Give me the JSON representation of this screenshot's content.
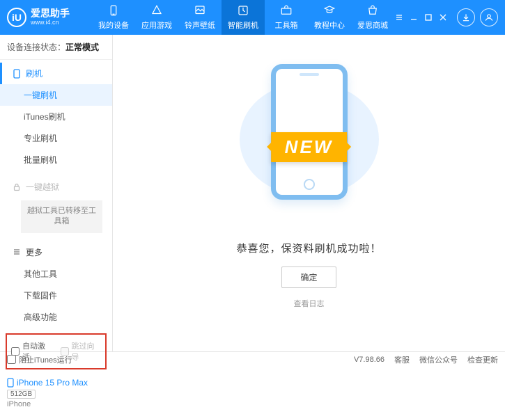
{
  "app": {
    "name": "爱思助手",
    "url": "www.i4.cn",
    "logo_letter": "iU"
  },
  "topnav": [
    {
      "label": "我的设备"
    },
    {
      "label": "应用游戏"
    },
    {
      "label": "铃声壁纸"
    },
    {
      "label": "智能刷机"
    },
    {
      "label": "工具箱"
    },
    {
      "label": "教程中心"
    },
    {
      "label": "爱思商城"
    }
  ],
  "conn": {
    "label": "设备连接状态：",
    "value": "正常模式"
  },
  "sidebar": {
    "flash_head": "刷机",
    "items_flash": [
      "一键刷机",
      "iTunes刷机",
      "专业刷机",
      "批量刷机"
    ],
    "jailbreak_head": "一键越狱",
    "jailbreak_note": "越狱工具已转移至工具箱",
    "more_head": "更多",
    "items_more": [
      "其他工具",
      "下载固件",
      "高级功能"
    ]
  },
  "options": {
    "auto_activate": "自动激活",
    "skip_setup": "跳过向导"
  },
  "device": {
    "name": "iPhone 15 Pro Max",
    "storage": "512GB",
    "type": "iPhone"
  },
  "main": {
    "ribbon": "NEW",
    "success": "恭喜您，保资料刷机成功啦！",
    "ok": "确定",
    "view_log": "查看日志"
  },
  "status": {
    "block_itunes": "阻止iTunes运行",
    "version": "V7.98.66",
    "support": "客服",
    "wechat": "微信公众号",
    "update": "检查更新"
  }
}
